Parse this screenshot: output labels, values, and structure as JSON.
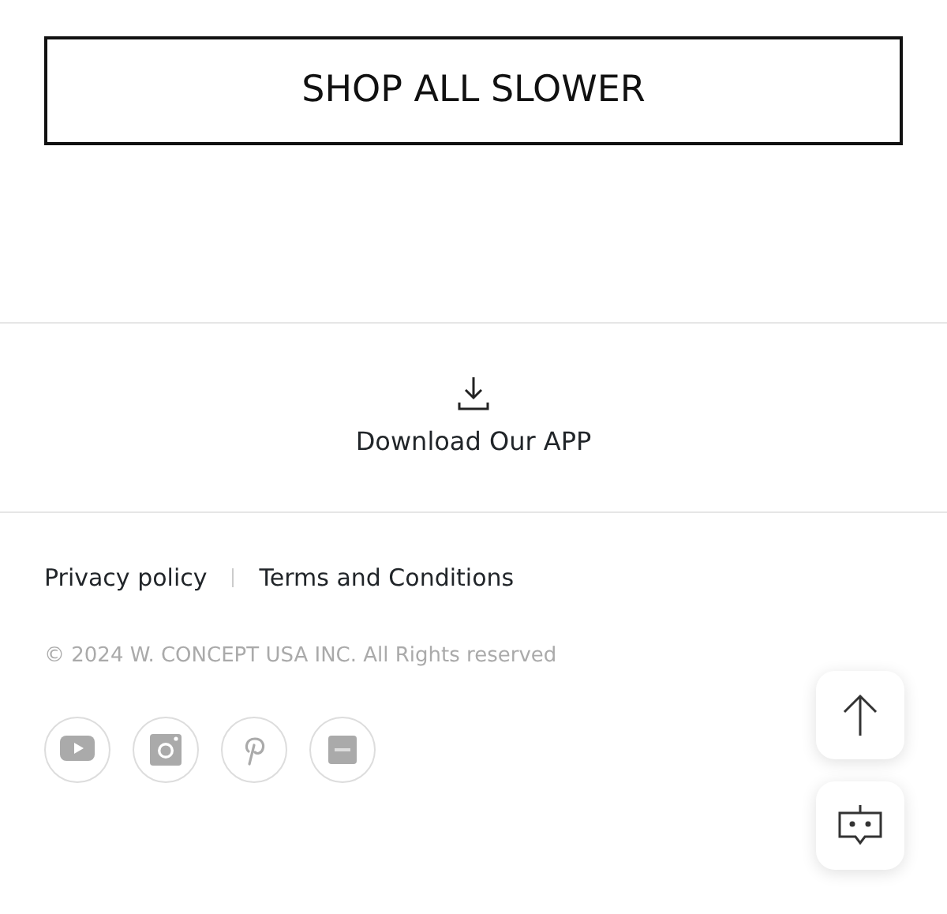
{
  "shop_button": {
    "label": "SHOP ALL SLOWER"
  },
  "app_download": {
    "label": "Download Our APP"
  },
  "footer_links": [
    "Privacy policy",
    "Terms and Conditions"
  ],
  "copyright": "© 2024 W. CONCEPT USA INC. All Rights reserved",
  "social": [
    {
      "kind": "youtube"
    },
    {
      "kind": "instagram"
    },
    {
      "kind": "pinterest"
    },
    {
      "kind": "app"
    }
  ]
}
